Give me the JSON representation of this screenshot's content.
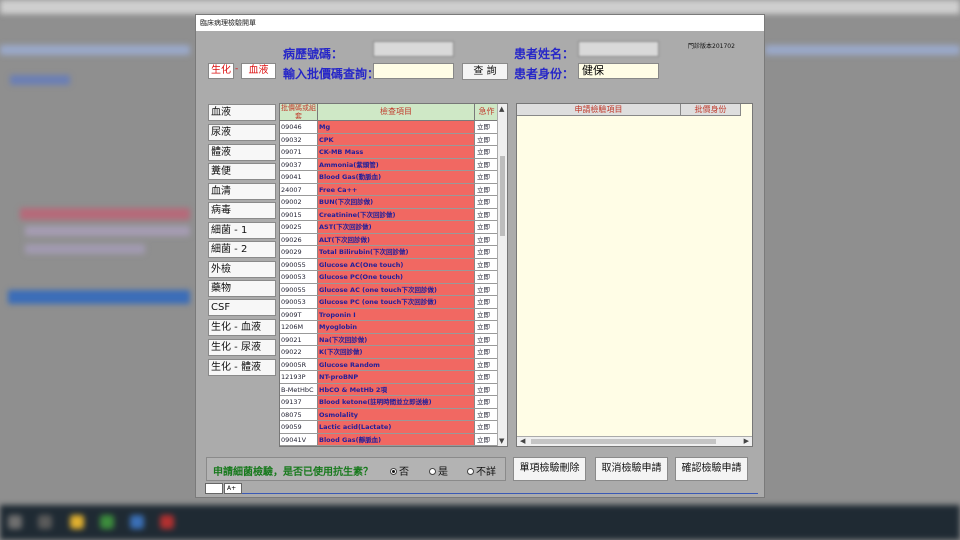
{
  "dialog": {
    "title": "臨床病理檢驗開單",
    "outpatient_version": "門診版本201702"
  },
  "header": {
    "chart_no_label": "病歷號碼：",
    "chart_no_value": "",
    "batch_code_label": "輸入批價碼查詢：",
    "batch_code_placeholder": "",
    "query_button": "查 詢",
    "patient_name_label": "患者姓名：",
    "patient_name_value": "",
    "identity_label": "患者身份：",
    "identity_value": "健保",
    "crumb_1": "生化",
    "crumb_sep": "-",
    "crumb_2": "血液"
  },
  "categories": [
    "血液",
    "尿液",
    "體液",
    "糞便",
    "血清",
    "病毒",
    "細菌 - 1",
    "細菌 - 2",
    "外檢",
    "藥物",
    "CSF",
    "生化 - 血液",
    "生化 - 尿液",
    "生化 - 體液"
  ],
  "test_table": {
    "headers": {
      "code": "批價碼或組套",
      "name": "檢查項目",
      "urgent": "急作"
    },
    "rows": [
      {
        "code": "09046",
        "name": "Mg",
        "urgent": "立即"
      },
      {
        "code": "09032",
        "name": "CPK",
        "urgent": "立即"
      },
      {
        "code": "09071",
        "name": "CK-MB Mass",
        "urgent": "立即"
      },
      {
        "code": "09037",
        "name": "Ammonia(紫頭管)",
        "urgent": "立即"
      },
      {
        "code": "09041",
        "name": "Blood Gas(動脈血)",
        "urgent": "立即"
      },
      {
        "code": "24007",
        "name": "Free Ca++",
        "urgent": "立即"
      },
      {
        "code": "09002",
        "name": "BUN(下次回診做)",
        "urgent": "立即"
      },
      {
        "code": "09015",
        "name": "Creatinine(下次回診做)",
        "urgent": "立即"
      },
      {
        "code": "09025",
        "name": "AST(下次回診做)",
        "urgent": "立即"
      },
      {
        "code": "09026",
        "name": "ALT(下次回診做)",
        "urgent": "立即"
      },
      {
        "code": "09029",
        "name": "Total Bilirubin(下次回診做)",
        "urgent": "立即"
      },
      {
        "code": "090055",
        "name": "Glucose AC(One touch)",
        "urgent": "立即"
      },
      {
        "code": "090053",
        "name": "Glucose PC(One touch)",
        "urgent": "立即"
      },
      {
        "code": "090055",
        "name": "Glucose AC (one touch下次回診做)",
        "urgent": "立即"
      },
      {
        "code": "090053",
        "name": "Glucose PC (one touch下次回診做)",
        "urgent": "立即"
      },
      {
        "code": "0909T",
        "name": "Troponin I",
        "urgent": "立即"
      },
      {
        "code": "1206M",
        "name": "Myoglobin",
        "urgent": "立即"
      },
      {
        "code": "09021",
        "name": "Na(下次回診做)",
        "urgent": "立即"
      },
      {
        "code": "09022",
        "name": "K(下次回診做)",
        "urgent": "立即"
      },
      {
        "code": "09005R",
        "name": "Glucose Random",
        "urgent": "立即"
      },
      {
        "code": "12193P",
        "name": "NT-proBNP",
        "urgent": "立即"
      },
      {
        "code": "B-MetHbC",
        "name": "HbCO & MetHb 2項",
        "urgent": "立即"
      },
      {
        "code": "09137",
        "name": "Blood ketone(註明時間並立即送檢)",
        "urgent": "立即"
      },
      {
        "code": "08075",
        "name": "Osmolality",
        "urgent": "立即"
      },
      {
        "code": "09059",
        "name": "Lactic acid(Lactate)",
        "urgent": "立即"
      },
      {
        "code": "09041V",
        "name": "Blood Gas(靜脈血)",
        "urgent": "立即"
      }
    ]
  },
  "request_table": {
    "headers": {
      "item": "申請檢驗項目",
      "identity": "批價身份"
    }
  },
  "antibiotic": {
    "question": "申請細菌檢驗，是否已使用抗生素？",
    "options": [
      {
        "label": "否",
        "selected": true
      },
      {
        "label": "是",
        "selected": false
      },
      {
        "label": "不詳",
        "selected": false
      }
    ]
  },
  "actions": {
    "delete_one": "單項檢驗刪除",
    "cancel": "取消檢驗申請",
    "confirm": "確認檢驗申請"
  },
  "status": {
    "box2": "A+"
  },
  "colors": {
    "row_red": "#f16862",
    "label_blue": "#2727c8",
    "header_green": "#cfe8c6"
  }
}
